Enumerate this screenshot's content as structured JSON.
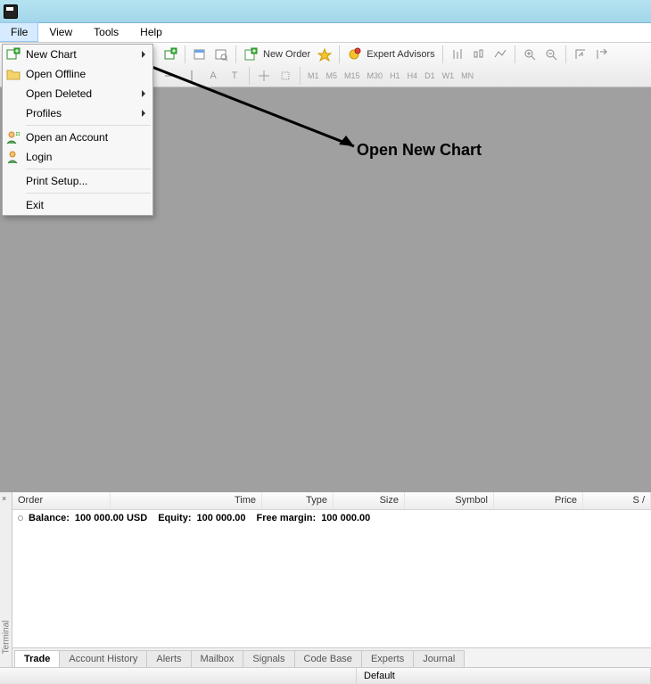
{
  "title": "",
  "menubar": {
    "file": "File",
    "view": "View",
    "tools": "Tools",
    "help": "Help"
  },
  "file_menu": {
    "new_chart": "New Chart",
    "open_offline": "Open Offline",
    "open_deleted": "Open Deleted",
    "profiles": "Profiles",
    "open_account": "Open an Account",
    "login": "Login",
    "print_setup": "Print Setup...",
    "exit": "Exit"
  },
  "toolbar": {
    "new_order": "New Order",
    "expert_advisors": "Expert Advisors",
    "timeframes": [
      "M1",
      "M5",
      "M15",
      "M30",
      "H1",
      "H4",
      "D1",
      "W1",
      "MN"
    ]
  },
  "annotation": "Open New Chart",
  "terminal": {
    "side_label": "Terminal",
    "columns": {
      "order": "Order",
      "time": "Time",
      "type": "Type",
      "size": "Size",
      "symbol": "Symbol",
      "price": "Price",
      "sl": "S /"
    },
    "summary": {
      "balance_label": "Balance:",
      "balance_value": "100 000.00 USD",
      "equity_label": "Equity:",
      "equity_value": "100 000.00",
      "margin_label": "Free margin:",
      "margin_value": "100 000.00"
    },
    "tabs": [
      "Trade",
      "Account History",
      "Alerts",
      "Mailbox",
      "Signals",
      "Code Base",
      "Experts",
      "Journal"
    ]
  },
  "statusbar": {
    "help": "",
    "default": "Default"
  }
}
